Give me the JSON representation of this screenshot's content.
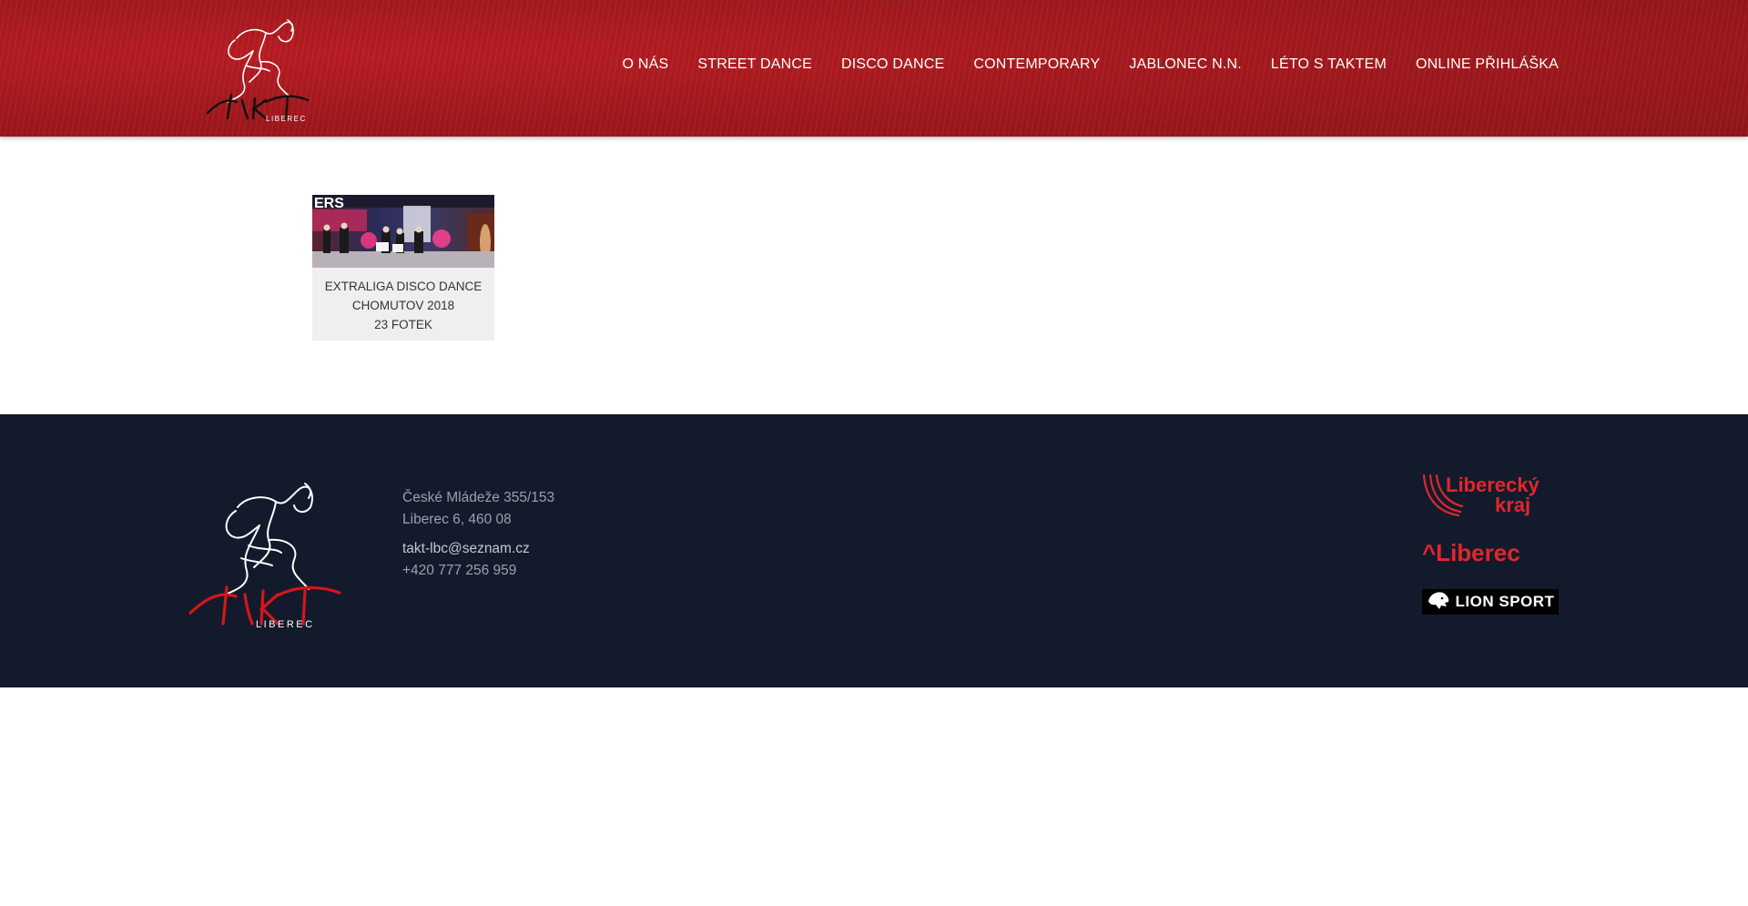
{
  "header": {
    "logo_text": "LIBEREC",
    "logo_brand": "TAKT",
    "nav": [
      {
        "label": "O NÁS"
      },
      {
        "label": "STREET DANCE"
      },
      {
        "label": "DISCO DANCE"
      },
      {
        "label": "CONTEMPORARY"
      },
      {
        "label": "JABLONEC N.N."
      },
      {
        "label": "LÉTO S TAKTEM"
      },
      {
        "label": "ONLINE PŘIHLÁŠKA"
      }
    ]
  },
  "gallery": {
    "title_line1": "EXTRALIGA DISCO DANCE",
    "title_line2": "CHOMUTOV 2018",
    "count": "23 FOTEK",
    "thumb_text": "ERS"
  },
  "footer": {
    "address_line1": "České Mládeže 355/153",
    "address_line2": "Liberec 6, 460 08",
    "email": "takt-lbc@seznam.cz",
    "phone": "+420 777 256 959",
    "sponsors": {
      "kraj_line1": "Liberecký",
      "kraj_line2": "kraj",
      "liberec": "^Liberec",
      "lion": "LION SPORT"
    }
  },
  "colors": {
    "header_red": "#a3181d",
    "footer_navy": "#131a2c",
    "sponsor_red": "#e2262b"
  }
}
